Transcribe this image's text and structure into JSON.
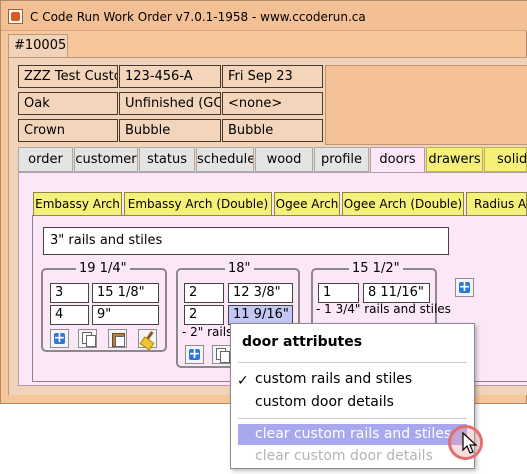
{
  "window": {
    "title": "C Code Run Work Order v7.0.1-1958 - www.ccoderun.ca"
  },
  "order_tab": "#10005",
  "info": {
    "customer": "ZZZ Test Customer",
    "phone": "123-456-A",
    "date": "Fri Sep 23",
    "wood": "Oak",
    "finish": "Unfinished (GC)",
    "other": "<none>",
    "profile1": "Crown",
    "profile2": "Bubble",
    "profile3": "Bubble"
  },
  "tabs": [
    "order",
    "customer",
    "status",
    "schedule",
    "wood",
    "profile",
    "doors",
    "drawers",
    "solid"
  ],
  "active_tab": "doors",
  "door_styles": [
    "Embassy Arch",
    "Embassy Arch (Double)",
    "Ogee Arch",
    "Ogee Arch (Double)",
    "Radius Arch"
  ],
  "rails_text": "3\" rails and stiles",
  "door_groups": [
    {
      "width": "19 1/4\"",
      "rows": [
        [
          "3",
          "15 1/8\""
        ],
        [
          "4",
          "9\""
        ]
      ],
      "note": ""
    },
    {
      "width": "18\"",
      "rows": [
        [
          "2",
          "12 3/8\""
        ],
        [
          "2",
          "11 9/16\""
        ]
      ],
      "note": "- 2\" rails"
    },
    {
      "width": "15 1/2\"",
      "rows": [
        [
          "1",
          "8 11/16\""
        ]
      ],
      "note": "- 1 3/4\" rails and stiles"
    }
  ],
  "context_menu": {
    "title": "door attributes",
    "items": [
      {
        "label": "custom rails and stiles",
        "checked": true,
        "enabled": true
      },
      {
        "label": "custom door details",
        "checked": false,
        "enabled": true
      },
      {
        "label": "clear custom rails and stiles",
        "checked": false,
        "enabled": true,
        "highlighted": true
      },
      {
        "label": "clear custom door details",
        "checked": false,
        "enabled": false
      }
    ],
    "check_glyph": "✓"
  },
  "colors": {
    "window_bg": "#f7c69b",
    "panel_pink": "#fbe7f7",
    "tab_yellow": "#f5f07a",
    "menu_highlight": "#a8a8ee"
  }
}
